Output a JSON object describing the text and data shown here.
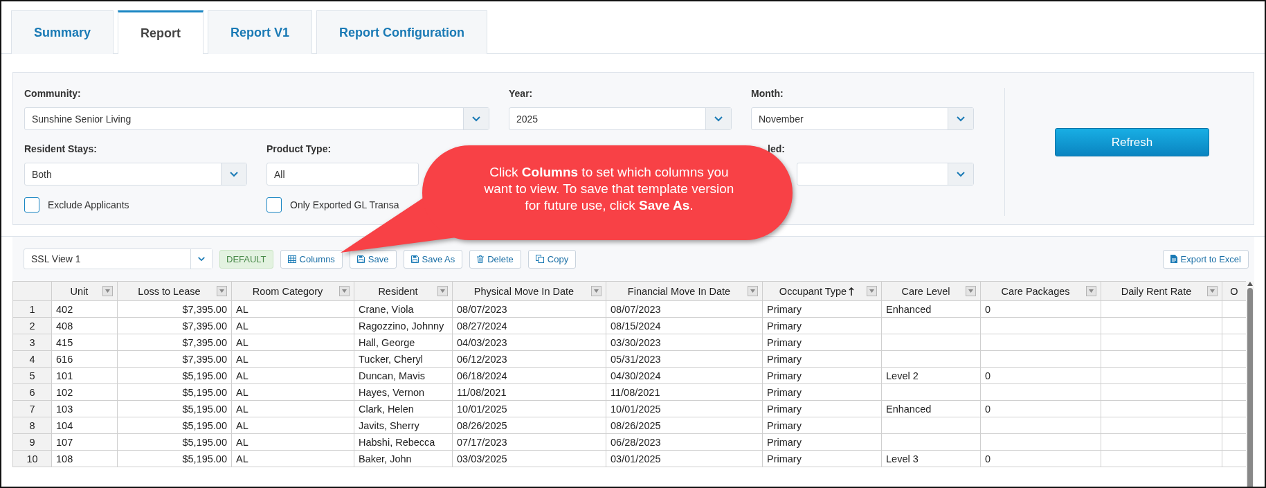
{
  "tabs": [
    {
      "label": "Summary",
      "selected": false
    },
    {
      "label": "Report",
      "selected": true
    },
    {
      "label": "Report V1",
      "selected": false
    },
    {
      "label": "Report Configuration",
      "selected": false
    }
  ],
  "filters": {
    "community": {
      "label": "Community:",
      "value": "Sunshine Senior Living"
    },
    "year": {
      "label": "Year:",
      "value": "2025"
    },
    "month": {
      "label": "Month:",
      "value": "November"
    },
    "resident_stays": {
      "label": "Resident Stays:",
      "value": "Both"
    },
    "product_type": {
      "label": "Product Type:",
      "value": "All"
    },
    "filter_4": {
      "label": "led:"
    },
    "checkboxes": [
      {
        "label": "Exclude Applicants",
        "checked": false
      },
      {
        "label": "Only Exported GL Transa",
        "checked": false
      }
    ],
    "refresh_button": "Refresh"
  },
  "callout": {
    "text": "Click **Columns** to set which columns you want to view. To save that template version for future use, click **Save As**."
  },
  "toolbar": {
    "view": "SSL View 1",
    "badge": "DEFAULT",
    "buttons": [
      {
        "label": "Columns"
      },
      {
        "label": "Save"
      },
      {
        "label": "Save As"
      },
      {
        "label": "Delete"
      },
      {
        "label": "Copy"
      }
    ],
    "export_button": "Export to Excel"
  },
  "table": {
    "columns": [
      {
        "label": "Unit",
        "filter": true,
        "sorted": false,
        "kind": "text"
      },
      {
        "label": "Loss to Lease",
        "filter": true,
        "sorted": false,
        "kind": "currency"
      },
      {
        "label": "Room Category",
        "filter": true,
        "sorted": false,
        "kind": "text"
      },
      {
        "label": "Resident",
        "filter": true,
        "sorted": false,
        "kind": "text"
      },
      {
        "label": "Physical Move In Date",
        "filter": true,
        "sorted": false,
        "kind": "text"
      },
      {
        "label": "Financial Move In Date",
        "filter": true,
        "sorted": false,
        "kind": "text"
      },
      {
        "label": "Occupant Type",
        "filter": true,
        "sorted": true,
        "kind": "text"
      },
      {
        "label": "Care Level",
        "filter": true,
        "sorted": false,
        "kind": "text"
      },
      {
        "label": "Care Packages",
        "filter": true,
        "sorted": false,
        "kind": "text"
      },
      {
        "label": "Daily Rent Rate",
        "filter": true,
        "sorted": false,
        "kind": "text"
      },
      {
        "label": "O",
        "filter": false,
        "sorted": false,
        "kind": "text"
      }
    ],
    "rows": [
      {
        "num": "1",
        "cells": [
          "402",
          "$7,395.00",
          "AL",
          "Crane, Viola",
          "08/07/2023",
          "08/07/2023",
          "Primary",
          "Enhanced",
          "0",
          "",
          ""
        ]
      },
      {
        "num": "2",
        "cells": [
          "408",
          "$7,395.00",
          "AL",
          "Ragozzino, Johnny",
          "08/27/2024",
          "08/15/2024",
          "Primary",
          "",
          "",
          "",
          ""
        ]
      },
      {
        "num": "3",
        "cells": [
          "415",
          "$7,395.00",
          "AL",
          "Hall, George",
          "04/03/2023",
          "03/30/2023",
          "Primary",
          "",
          "",
          "",
          ""
        ]
      },
      {
        "num": "4",
        "cells": [
          "616",
          "$7,395.00",
          "AL",
          "Tucker, Cheryl",
          "06/12/2023",
          "05/31/2023",
          "Primary",
          "",
          "",
          "",
          ""
        ]
      },
      {
        "num": "5",
        "cells": [
          "101",
          "$5,195.00",
          "AL",
          "Duncan, Mavis",
          "06/18/2024",
          "04/30/2024",
          "Primary",
          "Level 2",
          "0",
          "",
          ""
        ]
      },
      {
        "num": "6",
        "cells": [
          "102",
          "$5,195.00",
          "AL",
          "Hayes, Vernon",
          "11/08/2021",
          "11/08/2021",
          "Primary",
          "",
          "",
          "",
          ""
        ]
      },
      {
        "num": "7",
        "cells": [
          "103",
          "$5,195.00",
          "AL",
          "Clark, Helen",
          "10/01/2025",
          "10/01/2025",
          "Primary",
          "Enhanced",
          "0",
          "",
          ""
        ]
      },
      {
        "num": "8",
        "cells": [
          "104",
          "$5,195.00",
          "AL",
          "Javits, Sherry",
          "08/26/2025",
          "08/26/2025",
          "Primary",
          "",
          "",
          "",
          ""
        ]
      },
      {
        "num": "9",
        "cells": [
          "107",
          "$5,195.00",
          "AL",
          "Habshi, Rebecca",
          "07/17/2023",
          "06/28/2023",
          "Primary",
          "",
          "",
          "",
          ""
        ]
      },
      {
        "num": "10",
        "cells": [
          "108",
          "$5,195.00",
          "AL",
          "Baker, John",
          "03/03/2025",
          "03/01/2025",
          "Primary",
          "Level 3",
          "0",
          "",
          ""
        ]
      }
    ]
  }
}
